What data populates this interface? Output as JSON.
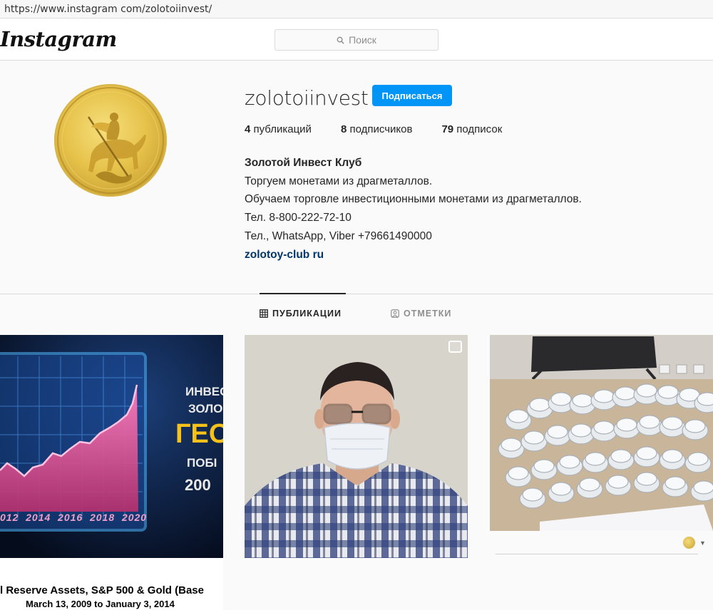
{
  "browser": {
    "url": "https://www.instagram com/zolotoiinvest/"
  },
  "nav": {
    "logo": "Instagram",
    "search_placeholder": "Поиск",
    "search_icon": "magnifier-icon"
  },
  "profile": {
    "username": "zolotoiinvest",
    "follow_label": "Подписаться",
    "stats": [
      {
        "count": "4",
        "label": "публикаций"
      },
      {
        "count": "8",
        "label": "подписчиков"
      },
      {
        "count": "79",
        "label": "подписок"
      }
    ],
    "bio": {
      "name": "Золотой Инвест Клуб",
      "lines": [
        "Торгуем монетами из драгметаллов.",
        "Обучаем торговле инвестиционными монетами из драгметаллов.",
        "Тел. 8-800-222-72-10",
        "Тел., WhatsApp, Viber +79661490000"
      ],
      "link": "zolotoy-club ru"
    },
    "avatar_icon": "gold-coin-st-george-icon"
  },
  "tabs": [
    {
      "label": "ПУБЛИКАЦИИ",
      "icon": "grid-icon",
      "active": true
    },
    {
      "label": "ОТМЕТКИ",
      "icon": "tagged-person-icon",
      "active": false
    }
  ],
  "posts": [
    {
      "overlay_lines": [
        "ИНВЕС",
        "ЗОЛО",
        "ГЕО",
        "ПОБІ",
        "200"
      ],
      "axis_years": "012  2014  2016  2018  2020",
      "caption_line1": "l Reserve Assets, S&P 500 & Gold (Base",
      "caption_line2": "March 13, 2009 to January 3, 2014"
    },
    {
      "description_icon": "multiple-photos-icon"
    },
    {
      "icon": "coin-avatar-icon"
    }
  ],
  "colors": {
    "accent": "#0095f6",
    "link": "#00376b",
    "chart_pink": "#f06aa8",
    "gold": "#e6c24a"
  }
}
